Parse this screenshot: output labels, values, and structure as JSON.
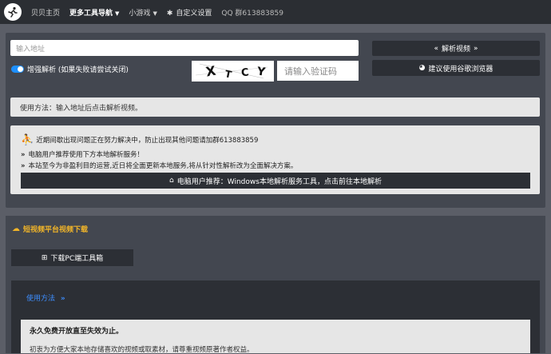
{
  "nav": {
    "home": "贝贝主页",
    "more_tools": "更多工具导航",
    "games": "小游戏",
    "custom_settings": "自定义设置",
    "qq_group": "QQ 群613883859"
  },
  "parse": {
    "url_placeholder": "输入地址",
    "parse_button": "解析视频",
    "enhanced_toggle_label": "增强解析 (如果失败请尝试关闭)",
    "captcha_text": "X T C Y",
    "captcha_placeholder": "请输入验证码",
    "browser_button": "建议使用谷歌浏览器"
  },
  "usage": "使用方法：输入地址后点击解析视频。",
  "notice": {
    "line1": "近期间歇出现问题正在努力解决中，防止出现其他问题请加群613883859",
    "line2": "电脑用户推荐使用下方本地解析服务！",
    "line3": "本站至今为非盈利目的运营,近日将全面更新本地服务,将从针对性解析改为全面解决方案。",
    "button": "电脑用户推荐：Windows本地解析服务工具，点击前往本地解析"
  },
  "short_video": {
    "title": "短视频平台视频下载",
    "pc_button": "下载PC端工具箱",
    "usage_link": "使用方法",
    "free_title": "永久免费开放直至失效为止。",
    "free_desc": "初衷为方便大家本地存储喜欢的视频或取素材，请尊重视频原著作者权益。"
  },
  "colors": {
    "accent_blue": "#1e90ff",
    "title_yellow": "#f0b429",
    "panel_bg": "#434750",
    "button_dark": "#2c2f35"
  }
}
